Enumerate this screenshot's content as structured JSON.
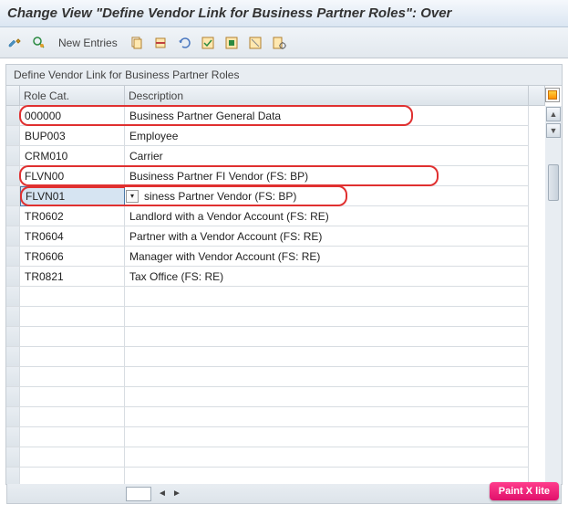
{
  "title": "Change View \"Define Vendor Link for Business Partner Roles\": Over",
  "toolbar": {
    "new_entries": "New Entries"
  },
  "panel_title": "Define Vendor Link for Business Partner Roles",
  "columns": {
    "role_cat": "Role Cat.",
    "description": "Description"
  },
  "rows": [
    {
      "role": "000000",
      "desc": "Business Partner General Data",
      "highlighted": true,
      "selected": false
    },
    {
      "role": "BUP003",
      "desc": "Employee",
      "highlighted": false,
      "selected": false
    },
    {
      "role": "CRM010",
      "desc": "Carrier",
      "highlighted": false,
      "selected": false
    },
    {
      "role": "FLVN00",
      "desc": "Business Partner FI Vendor (FS: BP)",
      "highlighted": true,
      "selected": false
    },
    {
      "role": "FLVN01",
      "desc": "Business Partner Vendor (FS: BP)",
      "highlighted": true,
      "selected": true
    },
    {
      "role": "TR0602",
      "desc": "Landlord with a Vendor Account (FS: RE)",
      "highlighted": false,
      "selected": false
    },
    {
      "role": "TR0604",
      "desc": "Partner with a Vendor Account (FS: RE)",
      "highlighted": false,
      "selected": false
    },
    {
      "role": "TR0606",
      "desc": "Manager with Vendor Account (FS: RE)",
      "highlighted": false,
      "selected": false
    },
    {
      "role": "TR0821",
      "desc": "Tax Office (FS: RE)",
      "highlighted": false,
      "selected": false
    }
  ],
  "watermark": "Paint X lite"
}
